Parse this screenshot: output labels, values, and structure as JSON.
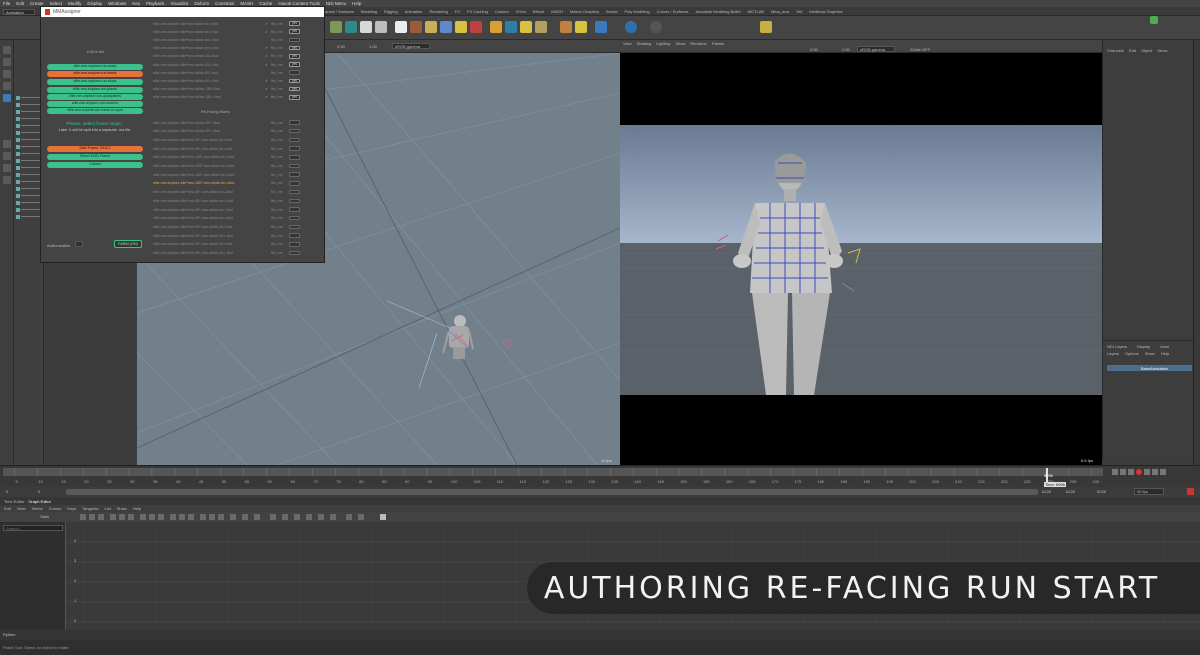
{
  "menu": [
    "File",
    "Edit",
    "Create",
    "Select",
    "Modify",
    "Display",
    "Windows",
    "Key",
    "Playback",
    "Visualize",
    "Deform",
    "Constrain",
    "MASH",
    "Cache",
    "Havok Content Tools",
    "NDI Menu",
    "Help"
  ],
  "mode": "Animation",
  "shelf_tabs": [
    "Curves / Surfaces",
    "Modeling",
    "Rigging",
    "Animation",
    "Rendering",
    "FX",
    "FX Caching",
    "Custom",
    "XGen",
    "Bifrost",
    "MASH",
    "Motion Graphics",
    "Arnold",
    "Poly Modeling",
    "Curves / Surfaces",
    "Autodesk Modeling Bullet",
    "MOTLAB",
    "Mtoa_ana",
    "Yeti",
    "Medieval Graphics"
  ],
  "workspace_label": "Main_window",
  "dialog": {
    "title": "MMAssigner",
    "subtitle": "Edit in file",
    "green_buttons_top": [
      "ellie-mm-explore-run-loops",
      "ellie-mm-explore-run-stops",
      "ellie-mm-explore-run-plants",
      "ellie-mm-explore-run-quickplants",
      "ellie-mm-explore-run-corners",
      "ellie-mm-explore-run-turns-on-spot"
    ],
    "orange_button_top": "ellie-mm-explore-run-starts",
    "prompt_heading": "Please, select frame range :",
    "prompt_sub": "Later, it will be split into a separate .ma file.",
    "start_frame_btn": "Start Frame: 001LC",
    "end_frame_btn": "Select END Frame",
    "cancel_btn": "Cancel",
    "author_label": "Authorization",
    "farm_btn": "FARM (ON)",
    "section_label": "Re-Facing Starts",
    "clips_top": [
      {
        "name": "ellie-mm-explore-idle*turn-stride-fw-l-ftod",
        "label": "fbx_ver",
        "checked": true,
        "badge": "yes"
      },
      {
        "name": "ellie-mm-explore-idle*turn-stride-fw-r-ftod",
        "label": "fbx_ver",
        "checked": true,
        "badge": "yes"
      },
      {
        "name": "ellie-mm-explore-idle*turn-stride-bw-l-ftod",
        "label": "fbx_ver",
        "checked": false,
        "badge": ""
      },
      {
        "name": "ellie-mm-explore-idle*turn-stride-bw-r-ftod",
        "label": "fbx_ver",
        "checked": true,
        "badge": "yes"
      },
      {
        "name": "ellie-mm-explore-idle*turn-stride-45-l-ftod",
        "label": "fbx_ver",
        "checked": true,
        "badge": "yes"
      },
      {
        "name": "ellie-mm-explore-idle*turn-stride-45-r-ftod",
        "label": "fbx_ver",
        "checked": true,
        "badge": "yes"
      },
      {
        "name": "ellie-mm-explore-idle*turn-stride-90-l-ftod",
        "label": "fbx_ver",
        "checked": false,
        "badge": ""
      },
      {
        "name": "ellie-mm-explore-idle*turn-stride-90-r-ftod",
        "label": "fbx_ver",
        "checked": true,
        "badge": "yes"
      },
      {
        "name": "ellie-mm-explore-idle*turn-stride-135-l-ftod",
        "label": "fbx_ver",
        "checked": true,
        "badge": "yes"
      },
      {
        "name": "ellie-mm-explore-idle*turn-stride-135-r-ftod",
        "label": "fbx_ver",
        "checked": true,
        "badge": "yes"
      }
    ],
    "clips_bottom": [
      {
        "name": "ellie-mm-explore-idle*turn-stride-45*-l-ftod",
        "label": "fbx_ver",
        "active": false
      },
      {
        "name": "ellie-mm-explore-idle*turn-stride-45*-r-ftod",
        "label": "fbx_ver",
        "active": false
      },
      {
        "name": "ellie-mm-explore-idle*turn-90*-turn-stride-fw-l-ftod",
        "label": "fbx_ver",
        "active": false
      },
      {
        "name": "ellie-mm-explore-idle*turn-90*-turn-stride-fw-r-ftod",
        "label": "fbx_ver",
        "active": false
      },
      {
        "name": "ellie-mm-explore-idle*turn-135*-turn-stride-fw-l-ftod",
        "label": "fbx_ver",
        "active": false
      },
      {
        "name": "ellie-mm-explore-idle*turn-135*-turn-stride-fw-r-ftod",
        "label": "fbx_ver",
        "active": false
      },
      {
        "name": "ellie-mm-explore-idle*turn-180*-turn-stride-fw-l-ftod",
        "label": "fbx_ver",
        "active": false
      },
      {
        "name": "ellie-mm-explore-idle*turn-180*-turn-stride-fw-r-ftod",
        "label": "fbx_ver",
        "active": true
      },
      {
        "name": "ellie-mm-explore-idle*turn-45*-turn-stride-bw-l-ftod",
        "label": "fbx_ver",
        "active": false
      },
      {
        "name": "ellie-mm-explore-idle*turn-45*-turn-stride-bw-r-ftod",
        "label": "fbx_ver",
        "active": false
      },
      {
        "name": "ellie-mm-explore-idle*turn-90*-turn-stride-bw-l-ftod",
        "label": "fbx_ver",
        "active": false
      },
      {
        "name": "ellie-mm-explore-idle*turn-90*-turn-stride-bw-r-ftod",
        "label": "fbx_ver",
        "active": false
      },
      {
        "name": "ellie-mm-explore-idle*turn-90*-turn-stride-90-l-ftod",
        "label": "fbx_ver",
        "active": false
      },
      {
        "name": "ellie-mm-explore-idle*turn-90*-turn-stride-90-r-ftod",
        "label": "fbx_ver",
        "active": false
      },
      {
        "name": "ellie-mm-explore-idle*turn-90*-turn-stride-90-l-ftod",
        "label": "fbx_ver",
        "active": false
      },
      {
        "name": "ellie-mm-explore-idle*turn-90*-turn-stride-90-r-ftod",
        "label": "fbx_ver",
        "active": false
      }
    ]
  },
  "viewport_left": {
    "fps": "11 fps",
    "camera": "sRGB gamma",
    "value_a": "0.00",
    "value_b": "1.00"
  },
  "viewport_right": {
    "menu": [
      "View",
      "Shading",
      "Lighting",
      "Show",
      "Renderer",
      "Panels"
    ],
    "fps": "6.6 fps",
    "camera": "sRGB gamma",
    "value_a": "0.00",
    "value_b": "1.00",
    "res": "2Gate OFF"
  },
  "channel_box": {
    "tabs": [
      "Channels",
      "Edit",
      "Object",
      "Show"
    ]
  },
  "layer_editor": {
    "tabs": [
      "NDI Layers",
      "Display",
      "Anim"
    ],
    "menu": [
      "Layers",
      "Options",
      "Show",
      "Help"
    ],
    "layer_name": "BaseAnimation"
  },
  "timeline": {
    "ticks": [
      "5",
      "10",
      "15",
      "20",
      "25",
      "30",
      "35",
      "40",
      "45",
      "50",
      "55",
      "60",
      "65",
      "70",
      "75",
      "80",
      "85",
      "90",
      "95",
      "100",
      "105",
      "110",
      "115",
      "120",
      "125",
      "130",
      "135",
      "140",
      "145",
      "150",
      "155",
      "160",
      "165",
      "170",
      "175",
      "180",
      "185",
      "190",
      "195",
      "200",
      "205",
      "210",
      "215",
      "220",
      "225",
      "230",
      "235",
      "240"
    ],
    "current": "5996",
    "tooltip": "Time: 5996"
  },
  "range": {
    "start": "0",
    "inner_start": "0",
    "inner_end": "6226",
    "end_a": "6226",
    "end_b": "6226",
    "fps": "30 fps"
  },
  "graph_editor": {
    "tabs": [
      "Time Editor",
      "Graph Editor"
    ],
    "menu": [
      "Edit",
      "View",
      "Select",
      "Curves",
      "Keys",
      "Tangents",
      "List",
      "Show",
      "Help"
    ],
    "stats_label": "Stats",
    "search_placeholder": "Search...",
    "y_labels": [
      "4",
      "3",
      "2",
      "1",
      "0"
    ]
  },
  "cmdline": {
    "label": "Python"
  },
  "helpline": {
    "text": "Pickle Tool: Select an object to rotate."
  },
  "banner": {
    "text": "AUTHORING RE-FACING RUN START"
  }
}
